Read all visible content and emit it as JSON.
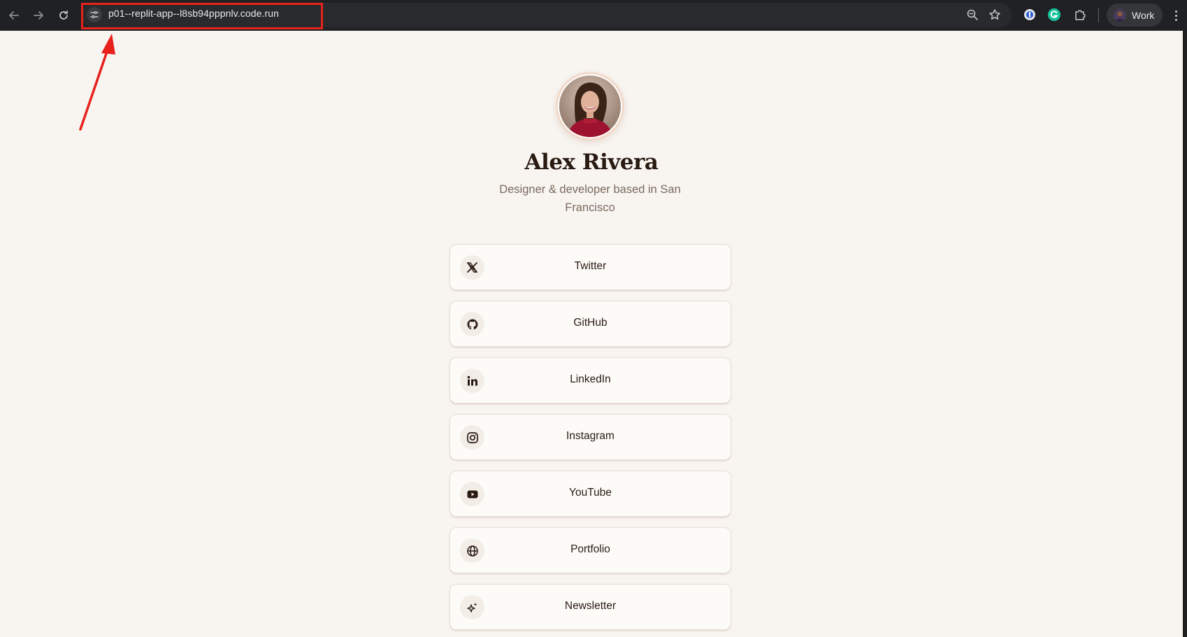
{
  "browser": {
    "url": "p01--replit-app--l8sb94pppnlv.code.run",
    "profile_label": "Work",
    "icons": [
      "back-icon",
      "forward-icon",
      "reload-icon",
      "site-info-icon",
      "zoom-icon",
      "bookmark-star-icon",
      "password-manager-icon",
      "grammarly-icon",
      "extensions-icon",
      "menu-icon"
    ]
  },
  "annotation": {
    "color": "#e8221b"
  },
  "profile": {
    "name": "Alex Rivera",
    "bio": "Designer & developer based in San Francisco"
  },
  "links": [
    {
      "label": "Twitter",
      "icon": "x-twitter-icon"
    },
    {
      "label": "GitHub",
      "icon": "github-icon"
    },
    {
      "label": "LinkedIn",
      "icon": "linkedin-icon"
    },
    {
      "label": "Instagram",
      "icon": "instagram-icon"
    },
    {
      "label": "YouTube",
      "icon": "youtube-icon"
    },
    {
      "label": "Portfolio",
      "icon": "globe-icon"
    },
    {
      "label": "Newsletter",
      "icon": "sparkles-icon"
    }
  ],
  "colors": {
    "page_bg": "#f8f5f1",
    "text_dark": "#2a1b12",
    "text_muted": "#7a6a5e",
    "card_bg": "#fdfbf8"
  }
}
